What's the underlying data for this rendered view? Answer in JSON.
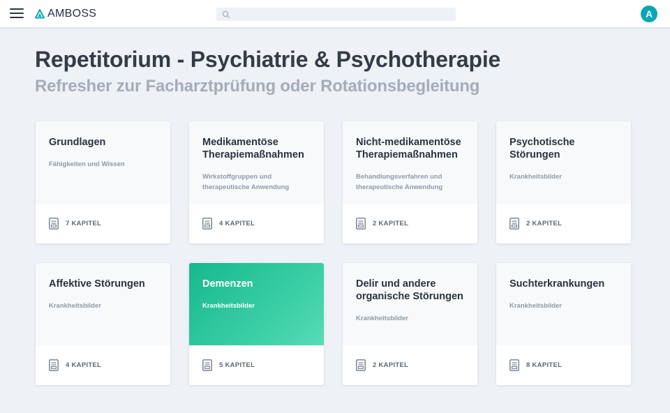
{
  "header": {
    "brand": "AMBOSS",
    "search_placeholder": "",
    "avatar_initial": "A",
    "accent_color": "#0aa6b8"
  },
  "page": {
    "title": "Repetitorium - Psychiatrie & Psychotherapie",
    "subtitle": "Refresher zur Facharztprüfung oder Rotationsbegleitung"
  },
  "cards": [
    {
      "title": "Grundlagen",
      "description": "Fähigkeiten und Wissen",
      "chapters": "7 KAPITEL"
    },
    {
      "title": "Medikamentöse Therapiemaßnahmen",
      "description": "Wirkstoffgruppen und therapeutische Anwendung",
      "chapters": "4 KAPITEL"
    },
    {
      "title": "Nicht-medikamentöse Therapiemaßnahmen",
      "description": "Behandlungsverfahren und therapeutische Anwendung",
      "chapters": "2 KAPITEL"
    },
    {
      "title": "Psychotische Störungen",
      "description": "Krankheitsbilder",
      "chapters": "2 KAPITEL"
    },
    {
      "title": "Affektive Störungen",
      "description": "Krankheitsbilder",
      "chapters": "4 KAPITEL"
    },
    {
      "title": "Demenzen",
      "description": "Krankheitsbilder",
      "chapters": "5 KAPITEL",
      "active": true
    },
    {
      "title": "Delir und andere organische Störungen",
      "description": "Krankheitsbilder",
      "chapters": "2 KAPITEL"
    },
    {
      "title": "Suchterkrankungen",
      "description": "Krankheitsbilder",
      "chapters": "8 KAPITEL"
    }
  ],
  "colors": {
    "active_card": "#17b88f",
    "background": "#eef1f5"
  },
  "icons": {
    "menu": "hamburger-menu-icon",
    "logo": "amboss-logo-icon",
    "search": "search-icon",
    "chapter": "document-icon"
  }
}
